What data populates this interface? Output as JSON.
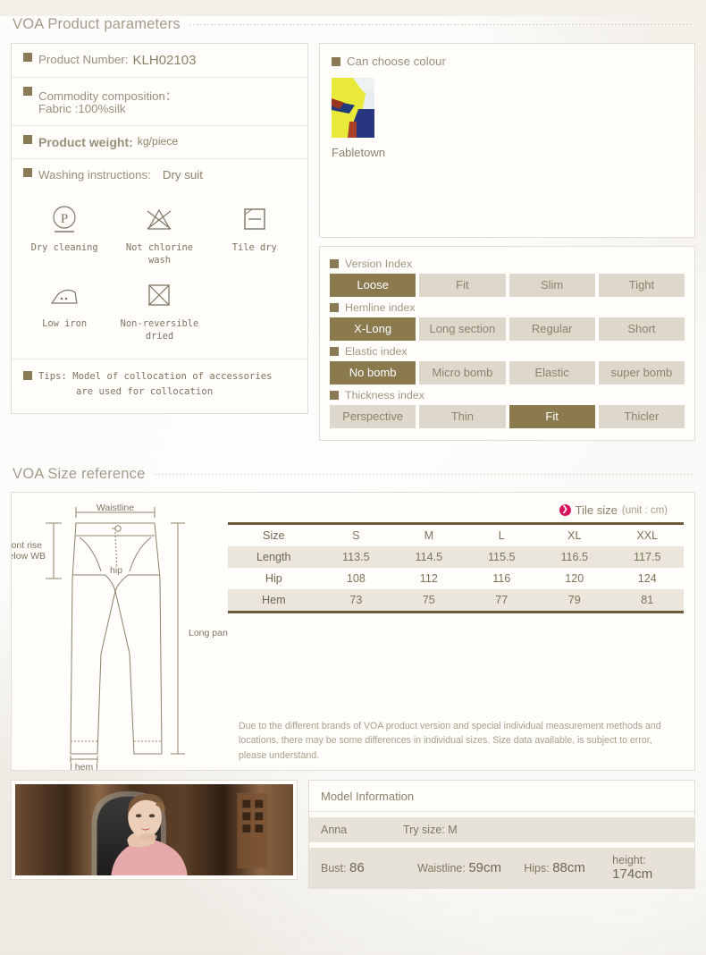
{
  "sections": {
    "product_params_title": "VOA Product parameters",
    "size_reference_title": "VOA Size reference"
  },
  "product": {
    "number_label": "Product Number:",
    "number_value": "KLH02103",
    "composition_label": "Commodity composition：",
    "composition_value": "Fabric  :100%silk",
    "weight_label": "Product  weight:",
    "weight_value": "kg/piece",
    "washing_label": "Washing instructions:",
    "washing_value": "Dry suit",
    "tips_label": "Tips:",
    "tips_line1": "Model of collocation of accessories",
    "tips_line2": "are used for collocation"
  },
  "care_icons": [
    {
      "name": "dry-cleaning-icon",
      "caption": "Dry cleaning"
    },
    {
      "name": "no-chlorine-wash-icon",
      "caption": "Not chlorine wash"
    },
    {
      "name": "tile-dry-icon",
      "caption": "Tile dry"
    },
    {
      "name": "low-iron-icon",
      "caption": "Low iron"
    },
    {
      "name": "non-reversible-dried-icon",
      "caption": "Non-reversible\ndried"
    }
  ],
  "colour": {
    "title": "Can choose colour",
    "swatch_name": "Fabletown"
  },
  "indexes": [
    {
      "label": "Version Index",
      "options": [
        "Loose",
        "Fit",
        "Slim",
        "Tight"
      ],
      "selected": 0
    },
    {
      "label": "Hemline index",
      "options": [
        "X-Long",
        "Long  section",
        "Regular",
        "Short"
      ],
      "selected": 0
    },
    {
      "label": "Elastic index",
      "options": [
        "No  bomb",
        "Micro bomb",
        "Elastic",
        "super  bomb"
      ],
      "selected": 0
    },
    {
      "label": "Thickness index",
      "options": [
        "Perspective",
        "Thin",
        "Fit",
        "Thicler"
      ],
      "selected": 2
    }
  ],
  "pants_diagram": {
    "waistline": "Waistline",
    "front_rise": "Front rise\nbelow WB",
    "hip": "hip",
    "long_pants": "Long pants",
    "hem": "hem"
  },
  "size_table": {
    "tile_label": "Tile size",
    "unit_label": "(unit : cm)",
    "arrow_glyph": "❯",
    "header": [
      "Size",
      "S",
      "M",
      "L",
      "XL",
      "XXL"
    ],
    "rows": [
      {
        "name": "Length",
        "values": [
          "113.5",
          "114.5",
          "115.5",
          "116.5",
          "117.5"
        ]
      },
      {
        "name": "Hip",
        "values": [
          "108",
          "112",
          "116",
          "120",
          "124"
        ]
      },
      {
        "name": "Hem",
        "values": [
          "73",
          "75",
          "77",
          "79",
          "81"
        ]
      }
    ],
    "disclaimer": "Due to the different brands of VOA product version and special individual measurement methods and locations, there may be some differences in individual sizes. Size data available, is subject to error, please understand."
  },
  "model": {
    "title": "Model Information",
    "name": "Anna",
    "try_size_label": "Try size:",
    "try_size_value": "M",
    "bust_label": "Bust:",
    "bust_value": "86",
    "waistline_label": "Waistline:",
    "waistline_value": "59cm",
    "hips_label": "Hips:",
    "hips_value": "88cm",
    "height_label": "height:",
    "height_value": "174cm"
  },
  "colors": {
    "accent": "#8a7a4e",
    "bullet": "#8a7a55",
    "tile_dot": "#d8125e",
    "table_border": "#6b5b3a",
    "chip_bg": "#ded8cc"
  }
}
